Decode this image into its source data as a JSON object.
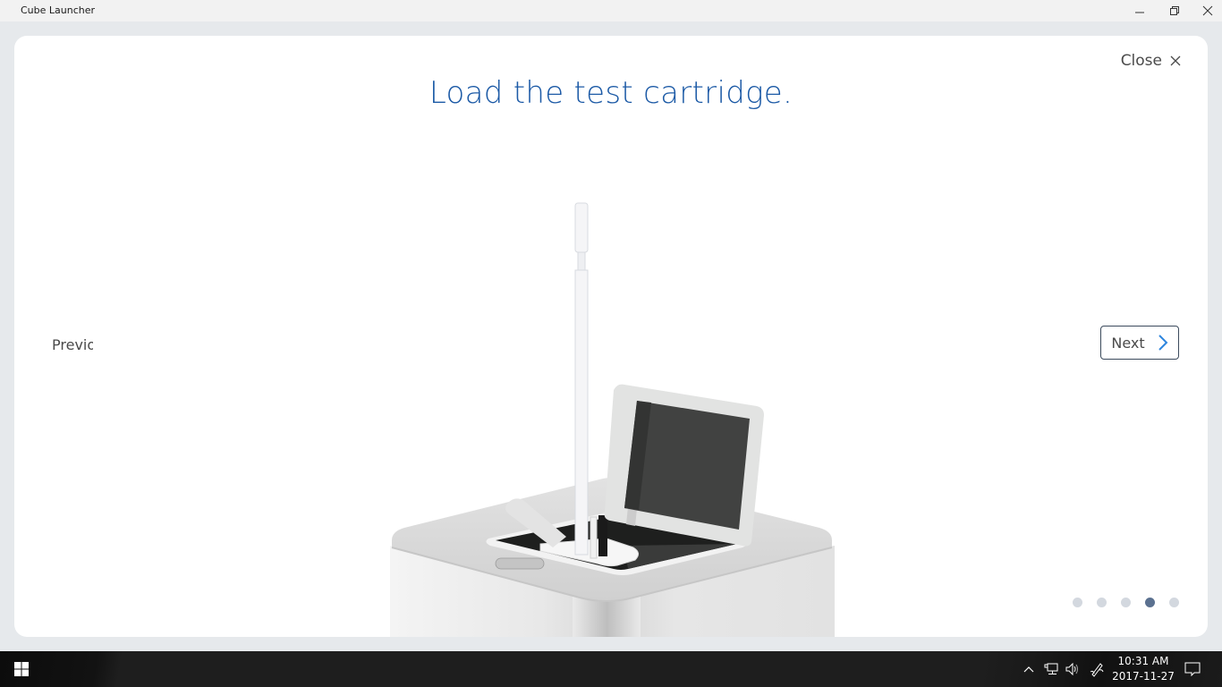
{
  "window": {
    "title": "Cube Launcher",
    "controls": [
      "minimize",
      "restore",
      "close"
    ]
  },
  "dialog": {
    "close_label": "Close",
    "headline": "Load the test cartridge.",
    "prev_label": "Previous",
    "next_label": "Next",
    "illustration": "cube-device-with-open-lid-and-cartridge",
    "steps": {
      "total": 5,
      "current": 4
    },
    "accent_color": "#1c5aa6",
    "next_arrow_color": "#2e86de",
    "active_dot_color": "#5b7190",
    "inactive_dot_color": "#d3d8df"
  },
  "taskbar": {
    "start_icon": "windows-logo-icon",
    "tray_icons": [
      "chevron-up-icon",
      "network-icon",
      "volume-icon",
      "pen-icon"
    ],
    "time": "10:31 AM",
    "date": "2017-11-27",
    "notification_icon": "action-center-icon"
  }
}
